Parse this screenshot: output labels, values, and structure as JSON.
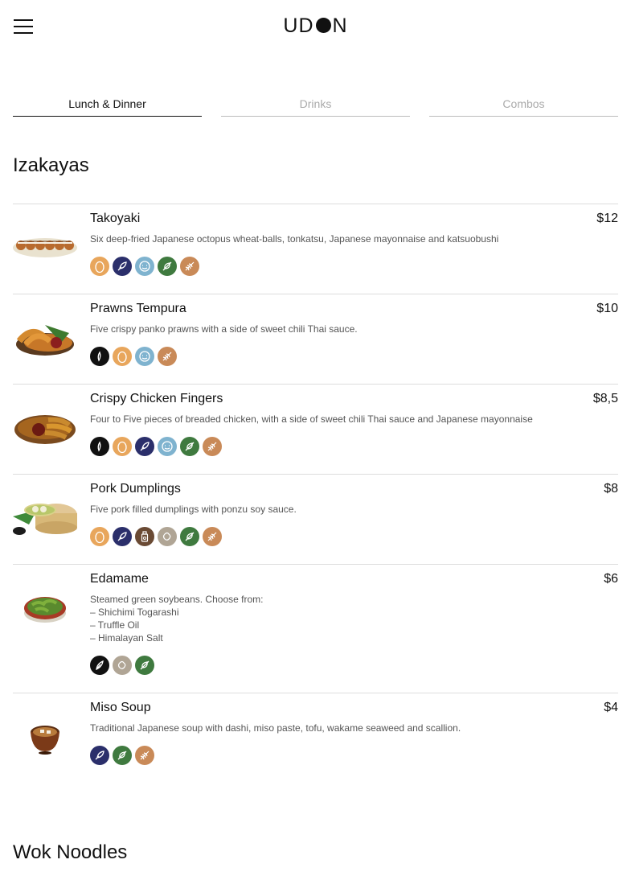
{
  "header": {
    "logo_left": "UD",
    "logo_right": "N"
  },
  "tabs": [
    {
      "label": "Lunch & Dinner",
      "active": true
    },
    {
      "label": "Drinks",
      "active": false
    },
    {
      "label": "Combos",
      "active": false
    }
  ],
  "sections": [
    {
      "title": "Izakayas"
    },
    {
      "title": "Wok Noodles"
    }
  ],
  "allergen_colors": {
    "egg": "#e8a65c",
    "fish": "#2b2f6b",
    "soy": "#7fb3cf",
    "celery": "#3f7a3f",
    "gluten": "#c98a58",
    "sesame": "#111111",
    "mustard": "#6a4a34",
    "peanut": "#b0a595",
    "vegan": "#111111"
  },
  "items": [
    {
      "name": "Takoyaki",
      "price": "$12",
      "description": "Six deep-fried Japanese octopus wheat-balls, tonkatsu, Japanese mayonnaise and katsuobushi",
      "tags": [
        "egg",
        "fish",
        "soy",
        "celery",
        "gluten"
      ]
    },
    {
      "name": "Prawns Tempura",
      "price": "$10",
      "description": "Five crispy panko prawns with a side of sweet chili Thai sauce.",
      "tags": [
        "sesame",
        "egg",
        "soy",
        "gluten"
      ]
    },
    {
      "name": "Crispy Chicken Fingers",
      "price": "$8,5",
      "description": "Four to Five pieces of breaded chicken, with a side of sweet chili Thai sauce and Japanese mayonnaise",
      "tags": [
        "sesame",
        "egg",
        "fish",
        "soy",
        "celery",
        "gluten"
      ]
    },
    {
      "name": "Pork Dumplings",
      "price": "$8",
      "description": "Five pork filled dumplings with ponzu soy sauce.",
      "tags": [
        "egg",
        "fish",
        "mustard",
        "peanut",
        "celery",
        "gluten"
      ]
    },
    {
      "name": "Edamame",
      "price": "$6",
      "description": "Steamed green soybeans. Choose from:\n– Shichimi Togarashi\n– Truffle Oil\n– Himalayan Salt",
      "tags": [
        "vegan",
        "peanut",
        "celery"
      ]
    },
    {
      "name": "Miso Soup",
      "price": "$4",
      "description": "Traditional Japanese soup with dashi, miso paste, tofu, wakame seaweed and scallion.",
      "tags": [
        "fish",
        "celery",
        "gluten"
      ]
    }
  ]
}
